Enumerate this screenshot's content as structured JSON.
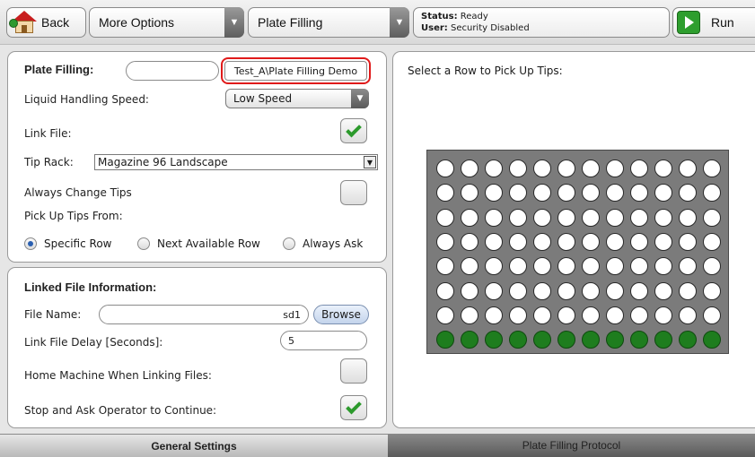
{
  "toolbar": {
    "back_label": "Back",
    "more_options_label": "More Options",
    "plate_filling_label": "Plate Filling",
    "status_key": "Status:",
    "status_value": "Ready",
    "user_key": "User:",
    "user_value": "Security Disabled",
    "run_label": "Run"
  },
  "settings": {
    "plate_filling_label": "Plate Filling:",
    "plate_filling_value": "Test_A\\Plate Filling Demo",
    "speed_label": "Liquid Handling Speed:",
    "speed_value": "Low Speed",
    "link_file_label": "Link File:",
    "link_file_checked": true,
    "tip_rack_label": "Tip Rack:",
    "tip_rack_value": "Magazine 96 Landscape",
    "always_change_label": "Always Change Tips",
    "always_change_checked": false,
    "pick_up_label": "Pick Up Tips From:",
    "radio_options": [
      "Specific Row",
      "Next Available Row",
      "Always Ask"
    ],
    "radio_selected": "Specific Row"
  },
  "linked": {
    "title": "Linked File Information:",
    "file_name_label": "File Name:",
    "file_name_value": "sd1",
    "browse_label": "Browse",
    "delay_label": "Link File Delay [Seconds]:",
    "delay_value": "5",
    "home_label": "Home Machine When Linking Files:",
    "home_checked": false,
    "stop_label": "Stop and Ask Operator to Continue:",
    "stop_checked": true
  },
  "plate": {
    "instruction": "Select a Row to Pick Up Tips:",
    "rows": 8,
    "cols": 12,
    "filled_rows": [
      8
    ]
  },
  "tabs": {
    "general": "General Settings",
    "protocol": "Plate Filling Protocol"
  },
  "colors": {
    "highlight": "#e01a1a",
    "check_green": "#2c9a2c",
    "well_filled": "#1e7d1e",
    "plate_bg": "#7b7b7b"
  }
}
